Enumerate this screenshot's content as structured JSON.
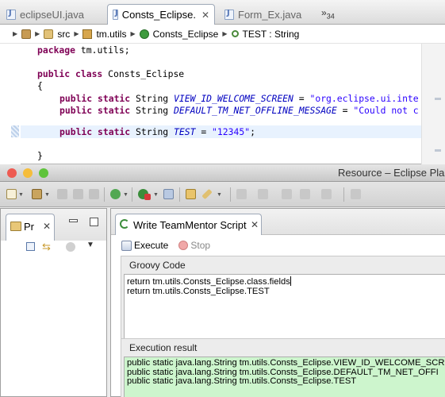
{
  "editor": {
    "tabs": [
      {
        "label": "eclipseUI.java",
        "active": false
      },
      {
        "label": "Consts_Eclipse.",
        "active": true
      },
      {
        "label": "Form_Ex.java",
        "active": false
      }
    ],
    "overflow_label": "»",
    "overflow_count": "34",
    "close_glyph": "✕",
    "breadcrumb": [
      {
        "label": "",
        "icon": "project-icon"
      },
      {
        "label": "src",
        "icon": "source-folder-icon"
      },
      {
        "label": "tm.utils",
        "icon": "package-icon"
      },
      {
        "label": "Consts_Eclipse",
        "icon": "class-icon"
      },
      {
        "label": "TEST : String",
        "icon": "static-field-icon"
      }
    ],
    "code": {
      "package_kw": "package",
      "package_name": " tm.utils;",
      "class_decl_kw": "public class",
      "class_name": " Consts_Eclipse",
      "open_brace": "{",
      "close_brace": "}",
      "field_mod": "public static",
      "field_type": " String ",
      "f1_name": "VIEW_ID_WELCOME_SCREEN",
      "f1_val": "\"org.eclipse.ui.inte",
      "f2_name": "DEFAULT_TM_NET_OFFLINE_MESSAGE",
      "f2_val": "\"Could not c",
      "f3_name": "TEST",
      "f3_val": "\"12345\"",
      "eq": " = ",
      "semi": ";"
    }
  },
  "window": {
    "title": "Resource – Eclipse Pla",
    "colors": {
      "close": "#ee5b52",
      "minimize": "#f5bd3c",
      "zoom": "#5fc33b"
    }
  },
  "left_view": {
    "tab_label": "Pr",
    "close_glyph": "✕"
  },
  "right_view": {
    "tab_label": "Write TeamMentor Script",
    "close_glyph": "✕",
    "execute_label": "Execute",
    "stop_label": "Stop",
    "groovy_title": "Groovy Code",
    "groovy_lines": [
      "return tm.utils.Consts_Eclipse.class.fields",
      "return tm.utils.Consts_Eclipse.TEST"
    ],
    "result_title": "Execution result",
    "result_lines": [
      "public static java.lang.String tm.utils.Consts_Eclipse.VIEW_ID_WELCOME_SCR",
      "public static java.lang.String tm.utils.Consts_Eclipse.DEFAULT_TM_NET_OFFI",
      "public static java.lang.String tm.utils.Consts_Eclipse.TEST"
    ]
  }
}
